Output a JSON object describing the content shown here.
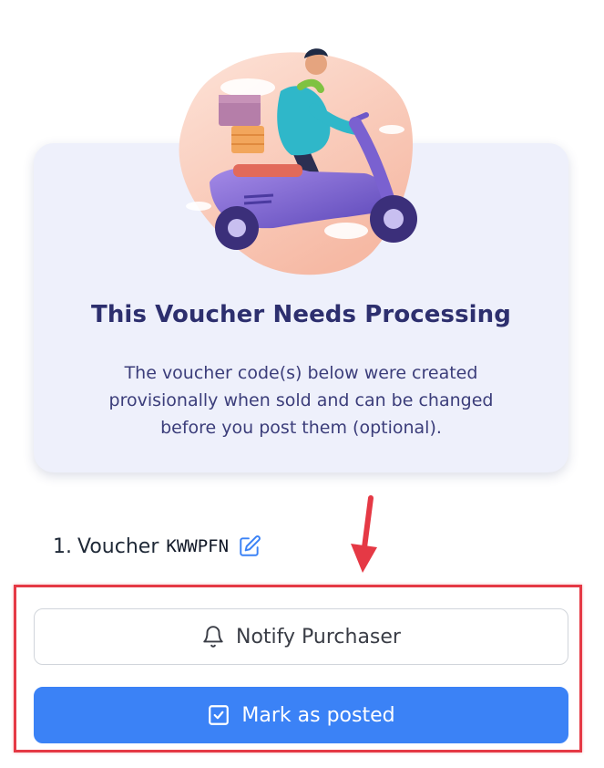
{
  "card": {
    "title": "This Voucher Needs Processing",
    "description": "The voucher code(s) below were created provisionally when sold and can be changed before you post them (optional)."
  },
  "voucher": {
    "index": "1.",
    "label": "Voucher",
    "code": "KWWPFN",
    "edit_icon": "edit-pencil-icon"
  },
  "buttons": {
    "notify_label": "Notify Purchaser",
    "notify_icon": "bell-icon",
    "posted_label": "Mark as posted",
    "posted_icon": "check-square-icon"
  },
  "colors": {
    "card_background": "#eef0fb",
    "title": "#2d2f6e",
    "primary": "#3b82f6",
    "annotation_red": "#e53945"
  }
}
